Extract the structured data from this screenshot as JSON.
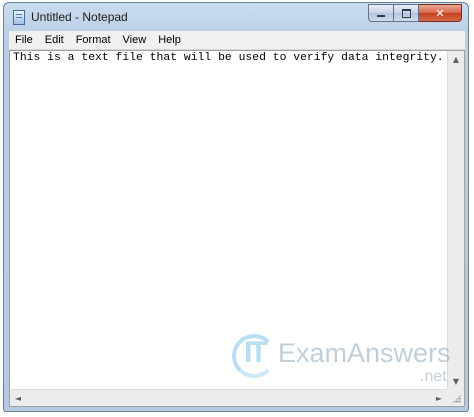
{
  "window": {
    "title": "Untitled - Notepad",
    "icon": "notepad-icon",
    "controls": {
      "minimize": "minimize-icon",
      "maximize": "maximize-icon",
      "close": "close-icon"
    }
  },
  "menu": [
    "File",
    "Edit",
    "Format",
    "View",
    "Help"
  ],
  "editor": {
    "content": "This is a text file that will be used to verify data integrity."
  },
  "scrollbar": {
    "up": "▲",
    "down": "▼",
    "left": "◄",
    "right": "►"
  },
  "watermark": {
    "logo_text": "IT",
    "brand": "ExamAnswers",
    "suffix": ".net"
  },
  "colors": {
    "close_button": "#c2421f",
    "watermark": "#7fc4e6"
  }
}
